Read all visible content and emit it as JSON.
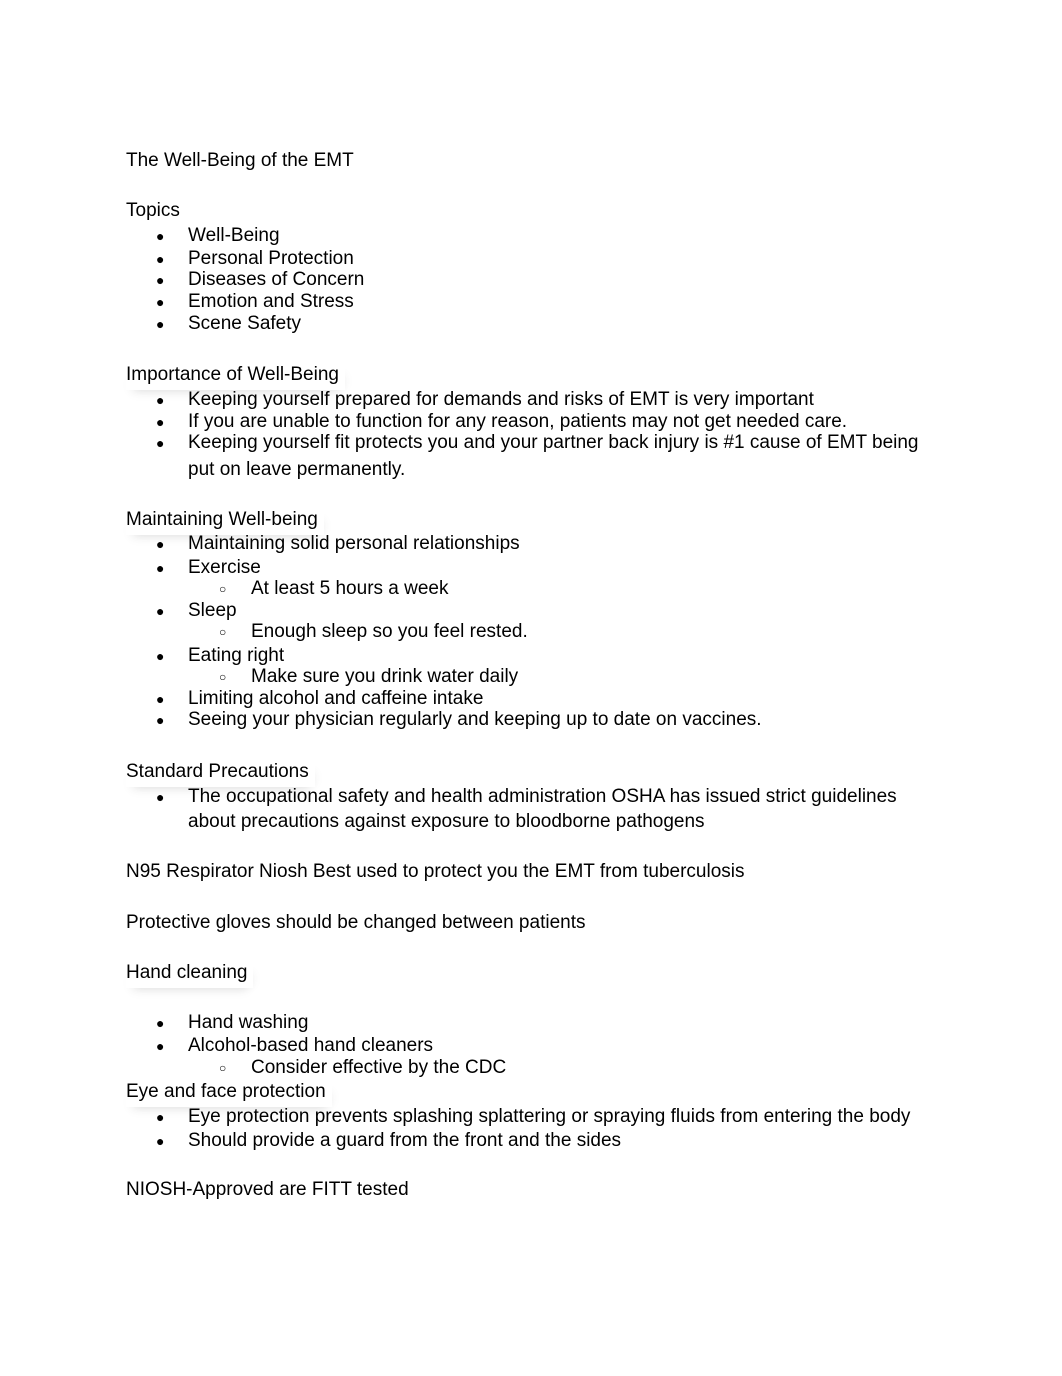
{
  "document": {
    "title": "The Well-Being of the EMT",
    "sections": {
      "topics": {
        "heading": "Topics",
        "items": [
          "Well-Being",
          "Personal Protection",
          "Diseases of Concern",
          "Emotion and Stress",
          "Scene Safety"
        ]
      },
      "importance": {
        "heading": "Importance of Well-Being",
        "items": [
          "Keeping yourself prepared for demands and risks of EMT is very important",
          "If you are unable to function for any reason, patients may not get needed care.",
          "Keeping yourself fit protects you and your partner back injury is #1 cause of EMT being",
          "put on leave permanently."
        ]
      },
      "maintaining": {
        "heading": "Maintaining Well-being",
        "items": [
          "Maintaining solid personal relationships",
          "Exercise",
          "At least 5 hours a week",
          "Sleep",
          "Enough sleep so you feel rested.",
          "Eating right",
          "Make sure you drink water daily",
          "Limiting alcohol and caffeine intake",
          "Seeing your physician regularly and keeping up to date on vaccines."
        ]
      },
      "standard": {
        "heading": "Standard Precautions",
        "items": [
          "The occupational safety and health administration OSHA has issued strict guidelines",
          "about precautions against exposure to bloodborne pathogens"
        ]
      },
      "n95": "N95 Respirator Niosh Best used to protect you the EMT from tuberculosis",
      "gloves": "Protective gloves should be changed between patients",
      "hand": {
        "heading": "Hand cleaning",
        "items": [
          "Hand washing",
          "Alcohol-based hand cleaners",
          "Consider effective by the CDC"
        ]
      },
      "eye": {
        "heading": "Eye and face protection",
        "items": [
          "Eye protection prevents splashing splattering or spraying fluids from entering the body",
          "Should provide a guard from the front and the sides"
        ]
      },
      "niosh": "NIOSH-Approved are FITT tested"
    },
    "bullet_glyph": "●",
    "sub_bullet_glyph": "○"
  }
}
